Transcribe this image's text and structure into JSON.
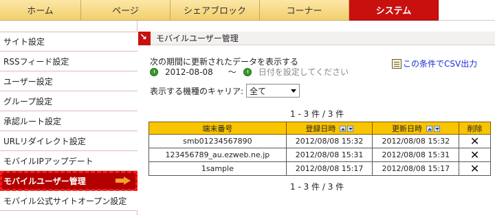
{
  "tabs": [
    {
      "label": "ホーム"
    },
    {
      "label": "ページ"
    },
    {
      "label": "シェアブロック"
    },
    {
      "label": "コーナー"
    },
    {
      "label": "システム",
      "active": true
    }
  ],
  "sidebar": {
    "items": [
      {
        "label": "サイト設定"
      },
      {
        "label": "RSSフィード設定"
      },
      {
        "label": "ユーザー設定"
      },
      {
        "label": "グループ設定"
      },
      {
        "label": "承認ルート設定"
      },
      {
        "label": "URLリダイレクト設定"
      },
      {
        "label": "モバイルIPアップデート"
      },
      {
        "label": "モバイルユーザー管理",
        "active": true
      },
      {
        "label": "モバイル公式サイトオープン設定"
      }
    ]
  },
  "section": {
    "title": "モバイルユーザー管理"
  },
  "period": {
    "label": "次の期間に更新されたデータを表示する",
    "from": "2012-08-08",
    "tilde": "～",
    "to_placeholder": "日付を設定してください"
  },
  "csv_link": "この条件でCSV出力",
  "carrier": {
    "label": "表示する機種のキャリア:",
    "selected": "全て"
  },
  "pagination": {
    "text": "1 - 3 件 / 3 件"
  },
  "table": {
    "headers": [
      "端末番号",
      "登録日時",
      "更新日時",
      "削除"
    ],
    "rows": [
      {
        "id": "smb01234567890",
        "registered": "2012/08/08 15:32",
        "updated": "2012/08/08 15:32",
        "delete": "✕"
      },
      {
        "id": "123456789_au.ezweb.ne.jp",
        "registered": "2012/08/08 15:31",
        "updated": "2012/08/08 15:31",
        "delete": "✕"
      },
      {
        "id": "1sample",
        "registered": "2012/08/08 15:17",
        "updated": "2012/08/08 15:17",
        "delete": "✕"
      }
    ]
  },
  "icons": {
    "section": "arrow-icon",
    "clock": "clock-icon",
    "csv": "document-icon",
    "sort_up": "sort-ascending-icon",
    "sort_down": "sort-descending-icon",
    "delete": "delete-x-icon",
    "active_arrow": "arrow-right-icon"
  },
  "colors": {
    "active_tab": "#c8100f",
    "tab_bg": "#f3cf6e",
    "table_header": "#f9c400",
    "link": "#1a2fd6",
    "highlight_outline": "#ff1a1a"
  }
}
